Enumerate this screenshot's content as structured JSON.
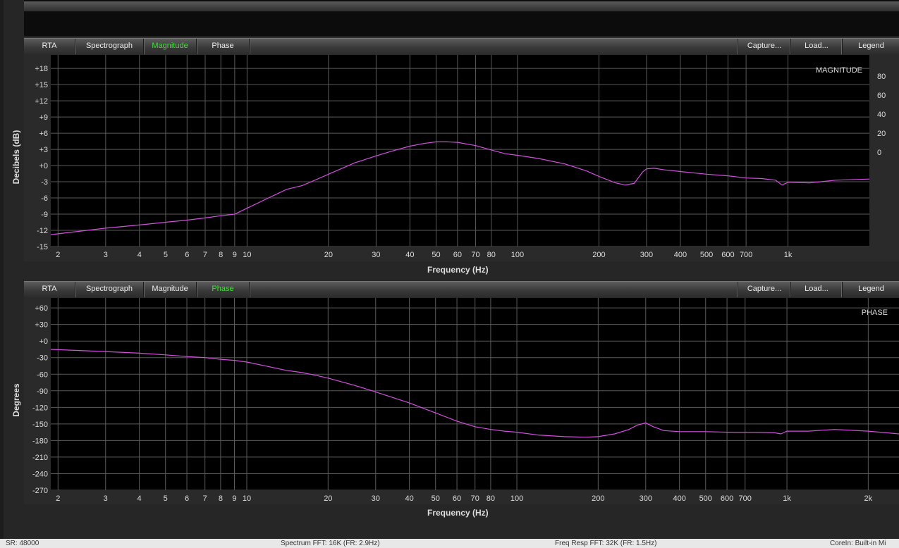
{
  "tabs": {
    "rta": "RTA",
    "spectrograph": "Spectrograph",
    "magnitude": "Magnitude",
    "phase": "Phase",
    "capture": "Capture...",
    "load": "Load...",
    "legend": "Legend"
  },
  "colors": {
    "accent_active_tab": "#39e62f",
    "trace": "#d44ee0",
    "plot_bg": "#000000",
    "grid": "#5a5a5a"
  },
  "chart_data": [
    {
      "type": "line",
      "title": "MAGNITUDE",
      "xlabel": "Frequency (Hz)",
      "ylabel": "Decibels (dB)",
      "x_scale": "log",
      "xlim": [
        1.88,
        2000
      ],
      "ylim": [
        -15,
        20.5
      ],
      "x_ticks": [
        2,
        3,
        4,
        5,
        6,
        7,
        8,
        9,
        10,
        20,
        30,
        40,
        50,
        60,
        70,
        80,
        100,
        200,
        300,
        400,
        500,
        600,
        700,
        1000
      ],
      "x_tick_labels": [
        "2",
        "3",
        "4",
        "5",
        "6",
        "7",
        "8",
        "9",
        "10",
        "20",
        "30",
        "40",
        "50",
        "60",
        "70",
        "80",
        "100",
        "200",
        "300",
        "400",
        "500",
        "600",
        "700",
        "1k"
      ],
      "y_ticks": [
        18,
        15,
        12,
        9,
        6,
        3,
        0,
        -3,
        -6,
        -9,
        -12,
        -15
      ],
      "y_tick_labels": [
        "+18",
        "+15",
        "+12",
        "+9",
        "+6",
        "+3",
        "+0",
        "-3",
        "-6",
        "-9",
        "-12",
        "-15"
      ],
      "y2_tick_labels": [
        "80",
        "60",
        "40",
        "20",
        "0"
      ],
      "grid": true,
      "series": [
        {
          "x": [
            1.88,
            3,
            4,
            5,
            6,
            7,
            8,
            9,
            10,
            12,
            14,
            16,
            18,
            20,
            25,
            30,
            35,
            40,
            45,
            50,
            55,
            60,
            70,
            80,
            90,
            100,
            120,
            150,
            180,
            200,
            230,
            250,
            270,
            290,
            300,
            320,
            350,
            400,
            500,
            600,
            700,
            800,
            900,
            950,
            1000,
            1200,
            1500,
            2000
          ],
          "y": [
            -12.8,
            -11.6,
            -11,
            -10.5,
            -10.1,
            -9.7,
            -9.3,
            -9,
            -7.9,
            -6,
            -4.4,
            -3.7,
            -2.6,
            -1.6,
            0.5,
            1.8,
            2.8,
            3.6,
            4.1,
            4.4,
            4.4,
            4.3,
            3.7,
            2.9,
            2.2,
            1.9,
            1.3,
            0.3,
            -1,
            -2,
            -3.2,
            -3.6,
            -3.3,
            -1.2,
            -0.6,
            -0.5,
            -0.8,
            -1.1,
            -1.6,
            -1.9,
            -2.3,
            -2.4,
            -2.7,
            -3.6,
            -3.1,
            -3.2,
            -2.7,
            -2.5
          ]
        }
      ]
    },
    {
      "type": "line",
      "title": "PHASE",
      "xlabel": "Frequency (Hz)",
      "ylabel": "Degrees",
      "x_scale": "log",
      "xlim": [
        1.88,
        2600
      ],
      "ylim": [
        -270,
        78
      ],
      "x_ticks": [
        2,
        3,
        4,
        5,
        6,
        7,
        8,
        9,
        10,
        20,
        30,
        40,
        50,
        60,
        70,
        80,
        100,
        200,
        300,
        400,
        500,
        600,
        700,
        1000,
        2000
      ],
      "x_tick_labels": [
        "2",
        "3",
        "4",
        "5",
        "6",
        "7",
        "8",
        "9",
        "10",
        "20",
        "30",
        "40",
        "50",
        "60",
        "70",
        "80",
        "100",
        "200",
        "300",
        "400",
        "500",
        "600",
        "700",
        "1k",
        "2k"
      ],
      "y_ticks": [
        60,
        30,
        0,
        -30,
        -60,
        -90,
        -120,
        -150,
        -180,
        -210,
        -240,
        -270
      ],
      "y_tick_labels": [
        "+60",
        "+30",
        "+0",
        "-30",
        "-60",
        "-90",
        "-120",
        "-150",
        "-180",
        "-210",
        "-240",
        "-270"
      ],
      "grid": true,
      "series": [
        {
          "x": [
            1.88,
            3,
            4,
            5,
            6,
            7,
            8,
            9,
            10,
            12,
            14,
            16,
            18,
            20,
            25,
            30,
            40,
            50,
            60,
            70,
            80,
            90,
            100,
            120,
            150,
            180,
            200,
            230,
            260,
            280,
            300,
            320,
            350,
            400,
            500,
            600,
            700,
            800,
            900,
            950,
            1000,
            1200,
            1500,
            2000,
            2600
          ],
          "y": [
            -15,
            -19,
            -22,
            -25,
            -28,
            -30,
            -33,
            -35,
            -38,
            -46,
            -53,
            -57,
            -62,
            -67,
            -80,
            -92,
            -112,
            -130,
            -145,
            -155,
            -160,
            -163,
            -165,
            -170,
            -173,
            -174,
            -173,
            -168,
            -160,
            -152,
            -148,
            -155,
            -162,
            -164,
            -164,
            -165,
            -165,
            -165,
            -166,
            -168,
            -163,
            -163,
            -160,
            -163,
            -168
          ]
        }
      ]
    }
  ],
  "status": {
    "sr": "SR: 48000",
    "spectrum": "Spectrum FFT: 16K (FR: 2.9Hz)",
    "freq_resp": "Freq Resp FFT: 32K (FR: 1.5Hz)",
    "core_in": "CoreIn: Built-in Mi"
  }
}
